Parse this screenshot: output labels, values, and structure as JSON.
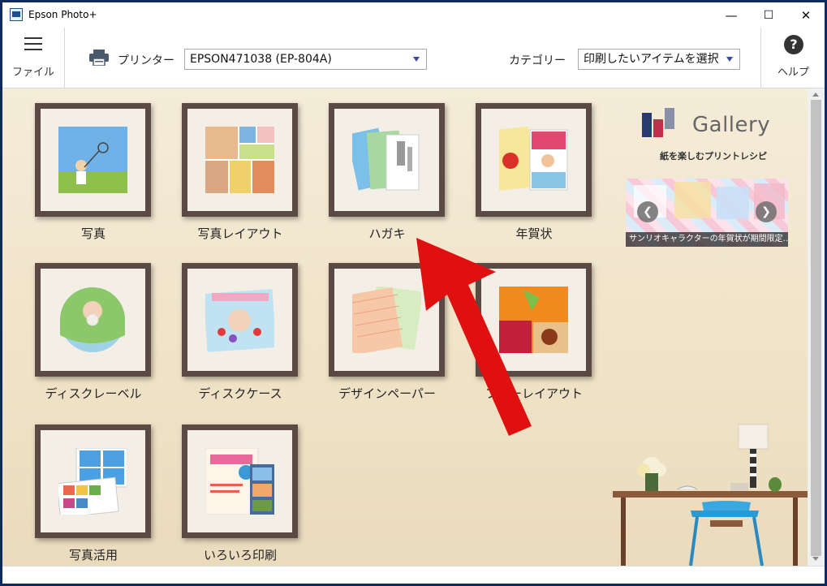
{
  "window": {
    "title": "Epson Photo+"
  },
  "titlebar_buttons": {
    "minimize": "—",
    "maximize": "☐",
    "close": "✕"
  },
  "toolbar": {
    "file_label": "ファイル",
    "printer_label": "プリンター",
    "printer_value": "EPSON471038 (EP-804A)",
    "category_label": "カテゴリー",
    "category_value": "印刷したいアイテムを選択",
    "help_label": "ヘルプ",
    "help_glyph": "?"
  },
  "tiles": [
    {
      "label": "写真",
      "icon": "photo-icon"
    },
    {
      "label": "写真レイアウト",
      "icon": "photo-layout-icon"
    },
    {
      "label": "ハガキ",
      "icon": "postcard-icon"
    },
    {
      "label": "年賀状",
      "icon": "new-year-card-icon"
    },
    {
      "label": "ディスクレーベル",
      "icon": "disc-label-icon"
    },
    {
      "label": "ディスクケース",
      "icon": "disc-case-icon"
    },
    {
      "label": "デザインペーパー",
      "icon": "design-paper-icon"
    },
    {
      "label": "フリーレイアウト",
      "icon": "free-layout-icon"
    },
    {
      "label": "写真活用",
      "icon": "photo-use-icon"
    },
    {
      "label": "いろいろ印刷",
      "icon": "various-print-icon"
    }
  ],
  "gallery": {
    "title": "Gallery",
    "subtitle": "紙を楽しむプリントレシピ",
    "banner_caption": "サンリオキャラクターの年賀状が期間限定…",
    "prev_arrow": "❮",
    "next_arrow": "❯"
  },
  "colors": {
    "accent_red": "#e01010",
    "frame": "#5a4a43",
    "background": "#f2e7cf"
  }
}
